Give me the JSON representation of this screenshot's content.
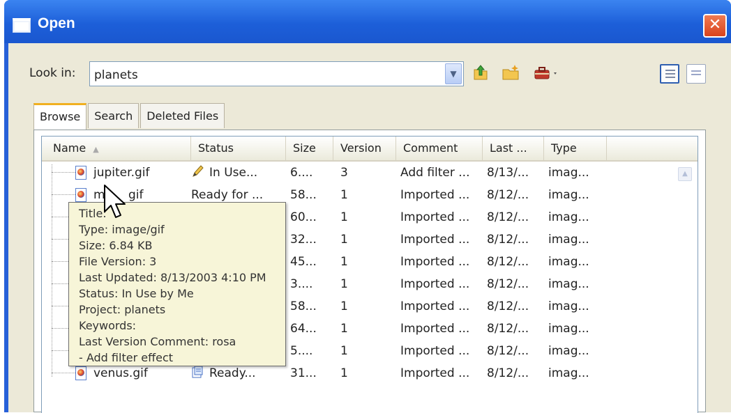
{
  "dialog": {
    "title": "Open",
    "close_glyph": "✕"
  },
  "lookin": {
    "label": "Look in:",
    "value": "planets"
  },
  "toolbar": {
    "icons": [
      "up-folder-icon",
      "new-folder-icon",
      "tools-icon"
    ],
    "views": [
      "details-view-icon",
      "list-view-icon"
    ]
  },
  "tabs": [
    {
      "label": "Browse",
      "active": true
    },
    {
      "label": "Search",
      "active": false
    },
    {
      "label": "Deleted Files",
      "active": false
    }
  ],
  "columns": [
    "Name",
    "Status",
    "Size",
    "Version",
    "Comment",
    "Last ...",
    "Type"
  ],
  "rows": [
    {
      "name": "jupiter.gif",
      "status": "In Use...",
      "size": "6....",
      "version": "3",
      "comment": "Add filter ...",
      "last": "8/13/...",
      "type": "imag..."
    },
    {
      "name": "m",
      "name_tail": "gif",
      "status": "Ready for ...",
      "size": "58...",
      "version": "1",
      "comment": "Imported ...",
      "last": "8/12/...",
      "type": "imag..."
    },
    {
      "name": "",
      "status": "",
      "size": "60...",
      "version": "1",
      "comment": "Imported ...",
      "last": "8/12/...",
      "type": "imag..."
    },
    {
      "name": "",
      "status": "",
      "size": "32...",
      "version": "1",
      "comment": "Imported ...",
      "last": "8/12/...",
      "type": "imag..."
    },
    {
      "name": "",
      "status": "",
      "size": "45...",
      "version": "1",
      "comment": "Imported ...",
      "last": "8/12/...",
      "type": "imag..."
    },
    {
      "name": "",
      "status": "",
      "size": "3....",
      "version": "1",
      "comment": "Imported ...",
      "last": "8/12/...",
      "type": "imag..."
    },
    {
      "name": "",
      "status": "",
      "size": "58...",
      "version": "1",
      "comment": "Imported ...",
      "last": "8/12/...",
      "type": "imag..."
    },
    {
      "name": "",
      "status": "",
      "size": "64...",
      "version": "1",
      "comment": "Imported ...",
      "last": "8/12/...",
      "type": "imag..."
    },
    {
      "name": "",
      "status": "",
      "size": "5....",
      "version": "1",
      "comment": "Imported ...",
      "last": "8/12/...",
      "type": "imag..."
    },
    {
      "name": "venus.gif",
      "status": "Ready...",
      "size": "31...",
      "version": "1",
      "comment": "Imported ...",
      "last": "8/12/...",
      "type": "imag..."
    }
  ],
  "tooltip": [
    "Title:",
    "Type: image/gif",
    "Size: 6.84 KB",
    "File Version: 3",
    "Last Updated: 8/13/2003 4:10 PM",
    "Status: In Use by Me",
    "Project: planets",
    "Keywords:",
    "Last Version Comment: rosa",
    "- Add filter effect"
  ],
  "colors": {
    "titlebar": "#2760d8",
    "dialog_bg": "#ece9d8",
    "tooltip_bg": "#f7f5d8",
    "tab_highlight": "#f0b020"
  }
}
